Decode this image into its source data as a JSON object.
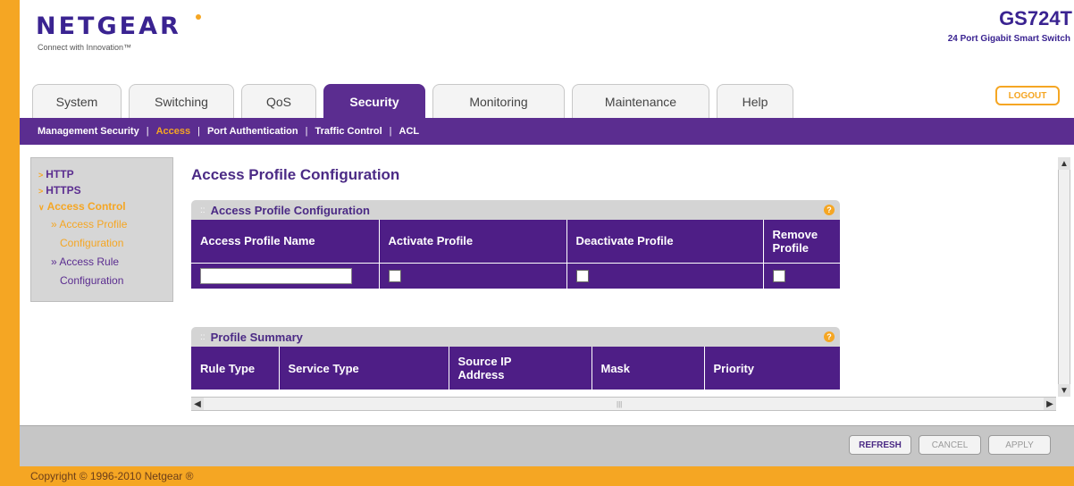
{
  "brand": {
    "logo": "NETGEAR",
    "tagline": "Connect with Innovation™",
    "model": "GS724T",
    "model_desc": "24 Port Gigabit Smart Switch"
  },
  "tabs": [
    "System",
    "Switching",
    "QoS",
    "Security",
    "Monitoring",
    "Maintenance",
    "Help"
  ],
  "active_tab": "Security",
  "logout_label": "LOGOUT",
  "subnav": [
    "Management Security",
    "Access",
    "Port Authentication",
    "Traffic Control",
    "ACL"
  ],
  "subnav_current": "Access",
  "sidebar": {
    "http": "HTTP",
    "https": "HTTPS",
    "access_control": "Access Control",
    "access_profile_1": "» Access Profile",
    "access_profile_2": "Configuration",
    "access_rule_1": "» Access Rule",
    "access_rule_2": "Configuration"
  },
  "page_title": "Access Profile Configuration",
  "profile_panel": {
    "title": "Access Profile Configuration",
    "headers": {
      "name": "Access Profile Name",
      "activate": "Activate Profile",
      "deactivate": "Deactivate Profile",
      "remove_1": "Remove",
      "remove_2": "Profile"
    },
    "name_value": ""
  },
  "summary_panel": {
    "title": "Profile Summary",
    "headers": {
      "rule_type": "Rule Type",
      "service_type": "Service Type",
      "source_ip_1": "Source IP",
      "source_ip_2": "Address",
      "mask": "Mask",
      "priority": "Priority"
    }
  },
  "buttons": {
    "refresh": "REFRESH",
    "cancel": "CANCEL",
    "apply": "APPLY"
  },
  "copyright": "Copyright © 1996-2010 Netgear ®",
  "colors": {
    "accent": "#f5a623",
    "purple": "#5b2d90"
  }
}
